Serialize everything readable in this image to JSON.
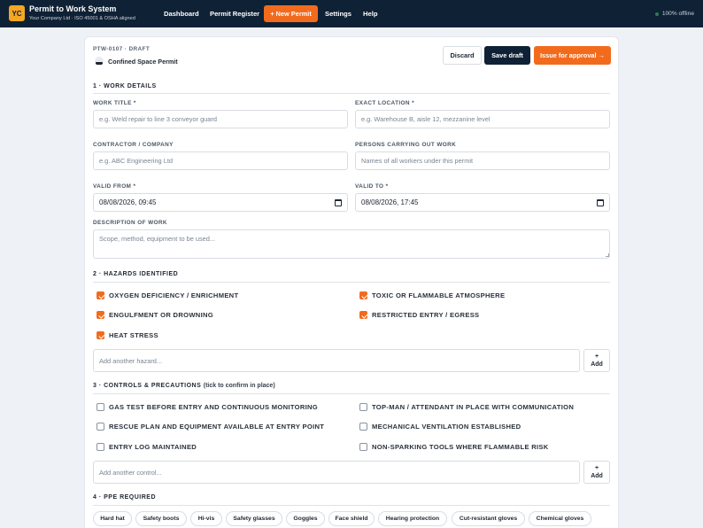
{
  "app": {
    "logo_text": "YC",
    "title": "Permit to Work System",
    "subtitle": "Your Company Ltd · ISO 45001 & OSHA aligned"
  },
  "nav": {
    "dashboard": "Dashboard",
    "register": "Permit Register",
    "new_permit": "+ New Permit",
    "settings": "Settings",
    "help": "Help"
  },
  "status": {
    "offline": "100% offline",
    "dot_color": "#2e7d4f"
  },
  "colors": {
    "accent": "#f26b1d",
    "navy": "#0f2135"
  },
  "permit": {
    "id": "PTW-0107 · DRAFT",
    "type": "Confined Space Permit"
  },
  "actions": {
    "discard": "Discard",
    "save": "Save draft",
    "issue": "Issue for approval →"
  },
  "work_details": {
    "title": "1 · WORK DETAILS",
    "work_title_label": "WORK TITLE *",
    "work_title_placeholder": "e.g. Weld repair to line 3 conveyor guard",
    "location_label": "EXACT LOCATION *",
    "location_placeholder": "e.g. Warehouse B, aisle 12, mezzanine level",
    "contractor_label": "CONTRACTOR / COMPANY",
    "contractor_placeholder": "e.g. ABC Engineering Ltd",
    "persons_label": "PERSONS CARRYING OUT WORK",
    "persons_placeholder": "Names of all workers under this permit",
    "valid_from_label": "VALID FROM *",
    "valid_from_value": "08/08/2026, 09:45",
    "valid_to_label": "VALID TO *",
    "valid_to_value": "08/08/2026, 17:45",
    "description_label": "DESCRIPTION OF WORK",
    "description_placeholder": "Scope, method, equipment to be used..."
  },
  "hazards": {
    "title": "2 · HAZARDS IDENTIFIED",
    "items": [
      {
        "label": "OXYGEN DEFICIENCY / ENRICHMENT",
        "checked": true
      },
      {
        "label": "TOXIC OR FLAMMABLE ATMOSPHERE",
        "checked": true
      },
      {
        "label": "ENGULFMENT OR DROWNING",
        "checked": true
      },
      {
        "label": "RESTRICTED ENTRY / EGRESS",
        "checked": true
      },
      {
        "label": "HEAT STRESS",
        "checked": true
      }
    ],
    "add_placeholder": "Add another hazard...",
    "add_plus": "+",
    "add_label": "Add"
  },
  "controls": {
    "title": "3 · CONTROLS & PRECAUTIONS",
    "hint": "(tick to confirm in place)",
    "items": [
      {
        "label": "GAS TEST BEFORE ENTRY AND CONTINUOUS MONITORING",
        "checked": false
      },
      {
        "label": "TOP-MAN / ATTENDANT IN PLACE WITH COMMUNICATION",
        "checked": false
      },
      {
        "label": "RESCUE PLAN AND EQUIPMENT AVAILABLE AT ENTRY POINT",
        "checked": false
      },
      {
        "label": "MECHANICAL VENTILATION ESTABLISHED",
        "checked": false
      },
      {
        "label": "ENTRY LOG MAINTAINED",
        "checked": false
      },
      {
        "label": "NON-SPARKING TOOLS WHERE FLAMMABLE RISK",
        "checked": false
      }
    ],
    "add_placeholder": "Add another control...",
    "add_plus": "+",
    "add_label": "Add"
  },
  "ppe": {
    "title": "4 · PPE REQUIRED",
    "items": [
      "Hard hat",
      "Safety boots",
      "Hi-vis",
      "Safety glasses",
      "Goggles",
      "Face shield",
      "Hearing protection",
      "Cut-resistant gloves",
      "Chemical gloves"
    ]
  }
}
